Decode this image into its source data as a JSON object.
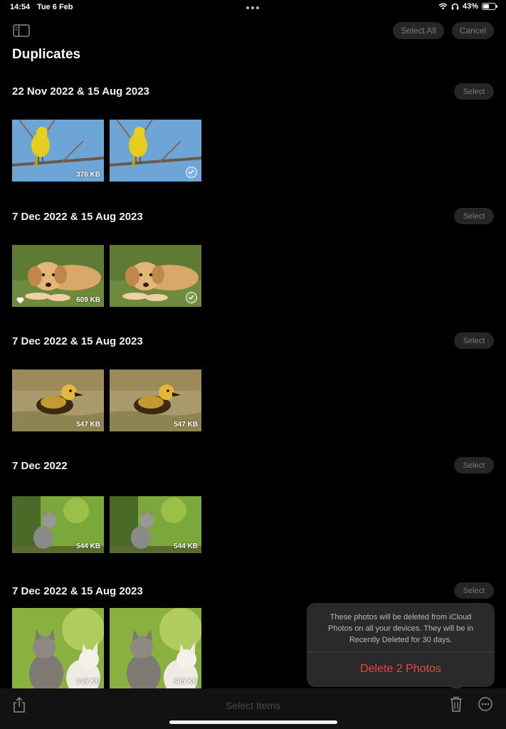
{
  "status_bar": {
    "time": "14:54",
    "date": "Tue 6 Feb",
    "battery": "43%"
  },
  "nav": {
    "select_all_label": "Select All",
    "cancel_label": "Cancel",
    "title": "Duplicates"
  },
  "groups": [
    {
      "title": "22 Nov 2022 & 15 Aug 2023",
      "select_label": "Select",
      "photos": [
        {
          "subject": "yellow-bird",
          "size": "376 KB"
        },
        {
          "subject": "yellow-bird",
          "size": ""
        }
      ]
    },
    {
      "title": "7 Dec 2022 & 15 Aug 2023",
      "select_label": "Select",
      "photos": [
        {
          "subject": "puppy",
          "size": "609 KB"
        },
        {
          "subject": "puppy",
          "size": ""
        }
      ]
    },
    {
      "title": "7 Dec 2022 & 15 Aug 2023",
      "select_label": "Select",
      "photos": [
        {
          "subject": "duckling",
          "size": "547 KB"
        },
        {
          "subject": "duckling",
          "size": "547 KB"
        }
      ]
    },
    {
      "title": "7 Dec 2022",
      "select_label": "Select",
      "photos": [
        {
          "subject": "kitten",
          "size": "544 KB"
        },
        {
          "subject": "kitten",
          "size": "544 KB"
        }
      ]
    },
    {
      "title": "7 Dec 2022 & 15 Aug 2023",
      "select_label": "Select",
      "photos": [
        {
          "subject": "kittens",
          "size": "645 KB"
        },
        {
          "subject": "kittens",
          "size": "645 KB"
        }
      ]
    }
  ],
  "popover": {
    "message": "These photos will be deleted from iCloud Photos on all your devices. They will be in Recently Deleted for 30 days.",
    "delete_label": "Delete 2 Photos"
  },
  "toolbar": {
    "label": "Select Items"
  },
  "colors": {
    "background": "#000000",
    "destructive": "#f0463c",
    "pill": "#262626"
  }
}
